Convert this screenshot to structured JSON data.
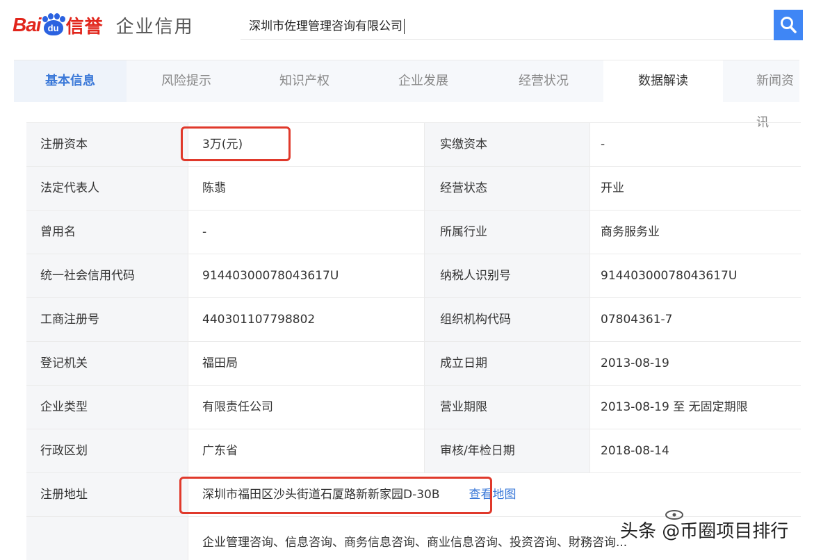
{
  "header": {
    "logo_bai": "Bai",
    "logo_du": "du",
    "logo_xinyu": "信誉",
    "product": "企业信用",
    "search_value": "深圳市佐理管理咨询有限公司",
    "search_icon": "search-icon",
    "accent": "#3f86f5",
    "brand_red": "#e1251b"
  },
  "tabs": [
    "基本信息",
    "风险提示",
    "知识产权",
    "企业发展",
    "经营状况",
    "数据解读",
    "新闻资讯"
  ],
  "table": {
    "rows": [
      {
        "label1": "注册资本",
        "value1": "3万(元)",
        "label2": "实缴资本",
        "value2": "-"
      },
      {
        "label1": "法定代表人",
        "value1": "陈翡",
        "label2": "经营状态",
        "value2": "开业"
      },
      {
        "label1": "曾用名",
        "value1": "-",
        "label2": "所属行业",
        "value2": "商务服务业"
      },
      {
        "label1": "统一社会信用代码",
        "value1": "91440300078043617U",
        "label2": "纳税人识别号",
        "value2": "91440300078043617U"
      },
      {
        "label1": "工商注册号",
        "value1": "440301107798802",
        "label2": "组织机构代码",
        "value2": "07804361-7"
      },
      {
        "label1": "登记机关",
        "value1": "福田局",
        "label2": "成立日期",
        "value2": "2013-08-19"
      },
      {
        "label1": "企业类型",
        "value1": "有限责任公司",
        "label2": "营业期限",
        "value2": "2013-08-19 至 无固定期限"
      },
      {
        "label1": "行政区划",
        "value1": "广东省",
        "label2": "审核/年检日期",
        "value2": "2018-08-14"
      }
    ],
    "address": {
      "label": "注册地址",
      "value": "深圳市福田区沙头街道石厦路新新家园D-30B",
      "map_link": "查看地图"
    },
    "scope": {
      "label": "",
      "value": "企业管理咨询、信息咨询、商务信息咨询、商业信息咨询、投资咨询、財務咨询..."
    }
  },
  "highlight_color": "#e0392b",
  "watermark": "头条 @币圈项目排行"
}
